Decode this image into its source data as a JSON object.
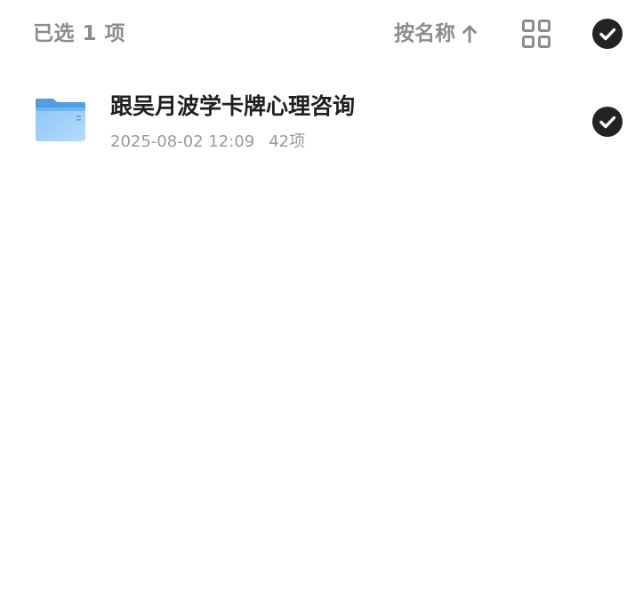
{
  "header": {
    "selected_label": "已选 1 项",
    "sort_label": "按名称",
    "sort_direction_icon": "arrow-up-icon",
    "view_toggle_icon": "grid-view-icon",
    "select_all_icon": "check-circle-icon"
  },
  "files": [
    {
      "name": "跟吴月波学卡牌心理咨询",
      "date": "2025-08-02 12:09",
      "count": "42项",
      "type_icon": "folder-icon",
      "selected": true
    }
  ],
  "colors": {
    "muted_text": "#8c8c8c",
    "primary_text": "#1f1f1f",
    "check_fill": "#232323",
    "folder_blue": "#5eaef2"
  }
}
